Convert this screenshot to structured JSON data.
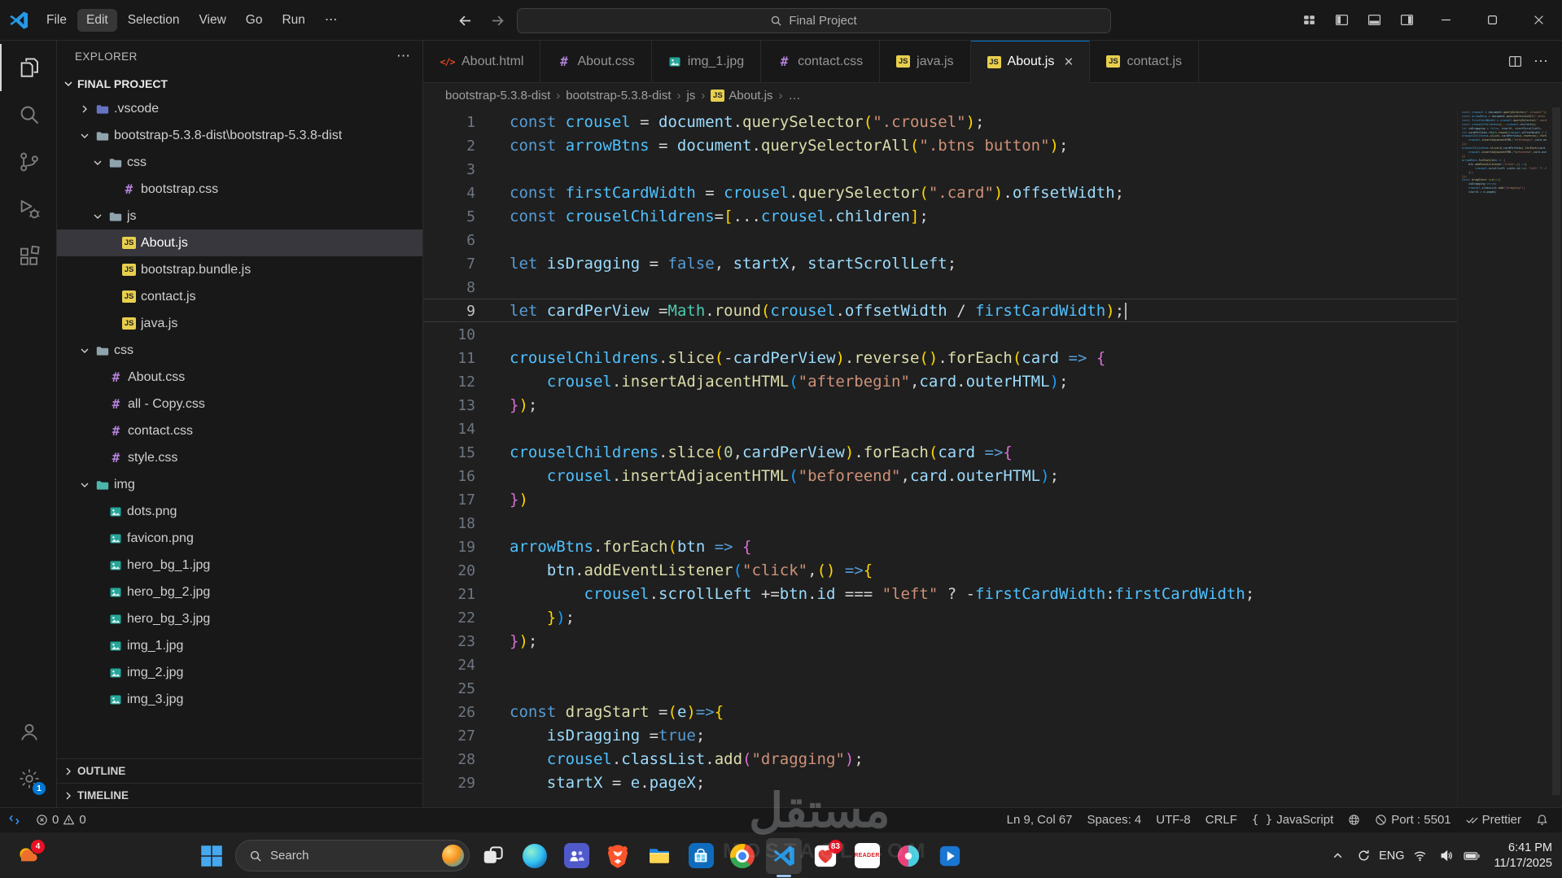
{
  "window": {
    "menus": [
      "File",
      "Edit",
      "Selection",
      "View",
      "Go",
      "Run"
    ],
    "active_menu": "Edit",
    "more_label": "⋯",
    "command_center_title": "Final Project"
  },
  "activity_bar": {
    "settings_badge": "1"
  },
  "sidebar": {
    "header": "EXPLORER",
    "section": "FINAL PROJECT",
    "tree": [
      {
        "label": ".vscode",
        "icon": "folder",
        "folder_color": "#6573c3",
        "chevron": "collapsed",
        "depth": 1
      },
      {
        "label": "bootstrap-5.3.8-dist\\bootstrap-5.3.8-dist",
        "icon": "folder",
        "folder_color": "#8fa3ad",
        "chevron": "expanded",
        "depth": 1
      },
      {
        "label": "css",
        "icon": "folder",
        "folder_color": "#8fa3ad",
        "chevron": "expanded",
        "depth": 2
      },
      {
        "label": "bootstrap.css",
        "icon": "css",
        "depth": 3
      },
      {
        "label": "js",
        "icon": "folder",
        "folder_color": "#8fa3ad",
        "chevron": "expanded",
        "depth": 2
      },
      {
        "label": "About.js",
        "icon": "js",
        "depth": 3,
        "selected": true
      },
      {
        "label": "bootstrap.bundle.js",
        "icon": "js",
        "depth": 3
      },
      {
        "label": "contact.js",
        "icon": "js",
        "depth": 3
      },
      {
        "label": "java.js",
        "icon": "js",
        "depth": 3
      },
      {
        "label": "css",
        "icon": "folder",
        "folder_color": "#8fa3ad",
        "chevron": "expanded",
        "depth": 1
      },
      {
        "label": "About.css",
        "icon": "css",
        "depth": 2
      },
      {
        "label": "all - Copy.css",
        "icon": "css",
        "depth": 2
      },
      {
        "label": "contact.css",
        "icon": "css",
        "depth": 2
      },
      {
        "label": "style.css",
        "icon": "css",
        "depth": 2
      },
      {
        "label": "img",
        "icon": "folder",
        "folder_color": "#4db6ac",
        "chevron": "expanded",
        "depth": 1
      },
      {
        "label": "dots.png",
        "icon": "img",
        "depth": 2
      },
      {
        "label": "favicon.png",
        "icon": "img",
        "depth": 2
      },
      {
        "label": "hero_bg_1.jpg",
        "icon": "img",
        "depth": 2
      },
      {
        "label": "hero_bg_2.jpg",
        "icon": "img",
        "depth": 2
      },
      {
        "label": "hero_bg_3.jpg",
        "icon": "img",
        "depth": 2
      },
      {
        "label": "img_1.jpg",
        "icon": "img",
        "depth": 2
      },
      {
        "label": "img_2.jpg",
        "icon": "img",
        "depth": 2
      },
      {
        "label": "img_3.jpg",
        "icon": "img",
        "depth": 2
      }
    ],
    "panels": [
      "OUTLINE",
      "TIMELINE"
    ]
  },
  "tabs": [
    {
      "label": "About.html",
      "icon": "html"
    },
    {
      "label": "About.css",
      "icon": "css"
    },
    {
      "label": "img_1.jpg",
      "icon": "img"
    },
    {
      "label": "contact.css",
      "icon": "css"
    },
    {
      "label": "java.js",
      "icon": "js"
    },
    {
      "label": "About.js",
      "icon": "js",
      "active": true
    },
    {
      "label": "contact.js",
      "icon": "js"
    }
  ],
  "breadcrumb": [
    "bootstrap-5.3.8-dist",
    "bootstrap-5.3.8-dist",
    "js",
    "About.js",
    "…"
  ],
  "editor": {
    "active_line": 9,
    "lines": [
      [
        [
          "k",
          "const "
        ],
        [
          "c",
          "crousel"
        ],
        [
          "p",
          " = "
        ],
        [
          "v",
          "document"
        ],
        [
          "p",
          "."
        ],
        [
          "f",
          "querySelector"
        ],
        [
          "b1",
          "("
        ],
        [
          "s",
          "\".crousel\""
        ],
        [
          "b1",
          ")"
        ],
        [
          "p",
          ";"
        ]
      ],
      [
        [
          "k",
          "const "
        ],
        [
          "c",
          "arrowBtns"
        ],
        [
          "p",
          " = "
        ],
        [
          "v",
          "document"
        ],
        [
          "p",
          "."
        ],
        [
          "f",
          "querySelectorAll"
        ],
        [
          "b1",
          "("
        ],
        [
          "s",
          "\".btns button\""
        ],
        [
          "b1",
          ")"
        ],
        [
          "p",
          ";"
        ]
      ],
      [],
      [
        [
          "k",
          "const "
        ],
        [
          "c",
          "firstCardWidth"
        ],
        [
          "p",
          " = "
        ],
        [
          "c",
          "crousel"
        ],
        [
          "p",
          "."
        ],
        [
          "f",
          "querySelector"
        ],
        [
          "b1",
          "("
        ],
        [
          "s",
          "\".card\""
        ],
        [
          "b1",
          ")"
        ],
        [
          "p",
          "."
        ],
        [
          "v",
          "offsetWidth"
        ],
        [
          "p",
          ";"
        ]
      ],
      [
        [
          "k",
          "const "
        ],
        [
          "c",
          "crouselChildrens"
        ],
        [
          "p",
          "="
        ],
        [
          "b1",
          "["
        ],
        [
          "p",
          "..."
        ],
        [
          "c",
          "crousel"
        ],
        [
          "p",
          "."
        ],
        [
          "v",
          "children"
        ],
        [
          "b1",
          "]"
        ],
        [
          "p",
          ";"
        ]
      ],
      [],
      [
        [
          "k",
          "let "
        ],
        [
          "v",
          "isDragging"
        ],
        [
          "p",
          " = "
        ],
        [
          "k",
          "false"
        ],
        [
          "p",
          ", "
        ],
        [
          "v",
          "startX"
        ],
        [
          "p",
          ", "
        ],
        [
          "v",
          "startScrollLeft"
        ],
        [
          "p",
          ";"
        ]
      ],
      [],
      [
        [
          "k",
          "let "
        ],
        [
          "v",
          "cardPerView"
        ],
        [
          "p",
          " ="
        ],
        [
          "t",
          "Math"
        ],
        [
          "p",
          "."
        ],
        [
          "f",
          "round"
        ],
        [
          "b1",
          "("
        ],
        [
          "c",
          "crousel"
        ],
        [
          "p",
          "."
        ],
        [
          "v",
          "offsetWidth"
        ],
        [
          "p",
          " / "
        ],
        [
          "c",
          "firstCardWidth"
        ],
        [
          "b1",
          ")"
        ],
        [
          "p",
          ";"
        ]
      ],
      [],
      [
        [
          "c",
          "crouselChildrens"
        ],
        [
          "p",
          "."
        ],
        [
          "f",
          "slice"
        ],
        [
          "b1",
          "("
        ],
        [
          "p",
          "-"
        ],
        [
          "v",
          "cardPerView"
        ],
        [
          "b1",
          ")"
        ],
        [
          "p",
          "."
        ],
        [
          "f",
          "reverse"
        ],
        [
          "b1",
          "()"
        ],
        [
          "p",
          "."
        ],
        [
          "f",
          "forEach"
        ],
        [
          "b1",
          "("
        ],
        [
          "v",
          "card"
        ],
        [
          "k",
          " => "
        ],
        [
          "b2",
          "{"
        ]
      ],
      [
        [
          "p",
          "    "
        ],
        [
          "c",
          "crousel"
        ],
        [
          "p",
          "."
        ],
        [
          "f",
          "insertAdjacentHTML"
        ],
        [
          "b3",
          "("
        ],
        [
          "s",
          "\"afterbegin\""
        ],
        [
          "p",
          ","
        ],
        [
          "v",
          "card"
        ],
        [
          "p",
          "."
        ],
        [
          "v",
          "outerHTML"
        ],
        [
          "b3",
          ")"
        ],
        [
          "p",
          ";"
        ]
      ],
      [
        [
          "b2",
          "}"
        ],
        [
          "b1",
          ")"
        ],
        [
          "p",
          ";"
        ]
      ],
      [],
      [
        [
          "c",
          "crouselChildrens"
        ],
        [
          "p",
          "."
        ],
        [
          "f",
          "slice"
        ],
        [
          "b1",
          "("
        ],
        [
          "n",
          "0"
        ],
        [
          "p",
          ","
        ],
        [
          "v",
          "cardPerView"
        ],
        [
          "b1",
          ")"
        ],
        [
          "p",
          "."
        ],
        [
          "f",
          "forEach"
        ],
        [
          "b1",
          "("
        ],
        [
          "v",
          "card"
        ],
        [
          "k",
          " =>"
        ],
        [
          "b2",
          "{"
        ]
      ],
      [
        [
          "p",
          "    "
        ],
        [
          "c",
          "crousel"
        ],
        [
          "p",
          "."
        ],
        [
          "f",
          "insertAdjacentHTML"
        ],
        [
          "b3",
          "("
        ],
        [
          "s",
          "\"beforeend\""
        ],
        [
          "p",
          ","
        ],
        [
          "v",
          "card"
        ],
        [
          "p",
          "."
        ],
        [
          "v",
          "outerHTML"
        ],
        [
          "b3",
          ")"
        ],
        [
          "p",
          ";"
        ]
      ],
      [
        [
          "b2",
          "}"
        ],
        [
          "b1",
          ")"
        ]
      ],
      [],
      [
        [
          "c",
          "arrowBtns"
        ],
        [
          "p",
          "."
        ],
        [
          "f",
          "forEach"
        ],
        [
          "b1",
          "("
        ],
        [
          "v",
          "btn"
        ],
        [
          "k",
          " => "
        ],
        [
          "b2",
          "{"
        ]
      ],
      [
        [
          "p",
          "    "
        ],
        [
          "v",
          "btn"
        ],
        [
          "p",
          "."
        ],
        [
          "f",
          "addEventListener"
        ],
        [
          "b3",
          "("
        ],
        [
          "s",
          "\"click\""
        ],
        [
          "p",
          ","
        ],
        [
          "b1",
          "()"
        ],
        [
          "k",
          " =>"
        ],
        [
          "b1",
          "{"
        ]
      ],
      [
        [
          "p",
          "        "
        ],
        [
          "c",
          "crousel"
        ],
        [
          "p",
          "."
        ],
        [
          "v",
          "scrollLeft"
        ],
        [
          "p",
          " +="
        ],
        [
          "v",
          "btn"
        ],
        [
          "p",
          "."
        ],
        [
          "v",
          "id"
        ],
        [
          "p",
          " === "
        ],
        [
          "s",
          "\"left\""
        ],
        [
          "p",
          " ? -"
        ],
        [
          "c",
          "firstCardWidth"
        ],
        [
          "p",
          ":"
        ],
        [
          "c",
          "firstCardWidth"
        ],
        [
          "p",
          ";"
        ]
      ],
      [
        [
          "p",
          "    "
        ],
        [
          "b1",
          "}"
        ],
        [
          "b3",
          ")"
        ],
        [
          "p",
          ";"
        ]
      ],
      [
        [
          "b2",
          "}"
        ],
        [
          "b1",
          ")"
        ],
        [
          "p",
          ";"
        ]
      ],
      [],
      [],
      [
        [
          "k",
          "const "
        ],
        [
          "f",
          "dragStart"
        ],
        [
          "p",
          " ="
        ],
        [
          "b1",
          "("
        ],
        [
          "v",
          "e"
        ],
        [
          "b1",
          ")"
        ],
        [
          "k",
          "=>"
        ],
        [
          "b1",
          "{"
        ]
      ],
      [
        [
          "p",
          "    "
        ],
        [
          "v",
          "isDragging"
        ],
        [
          "p",
          " ="
        ],
        [
          "k",
          "true"
        ],
        [
          "p",
          ";"
        ]
      ],
      [
        [
          "p",
          "    "
        ],
        [
          "c",
          "crousel"
        ],
        [
          "p",
          "."
        ],
        [
          "v",
          "classList"
        ],
        [
          "p",
          "."
        ],
        [
          "f",
          "add"
        ],
        [
          "b2",
          "("
        ],
        [
          "s",
          "\"dragging\""
        ],
        [
          "b2",
          ")"
        ],
        [
          "p",
          ";"
        ]
      ],
      [
        [
          "p",
          "    "
        ],
        [
          "v",
          "startX"
        ],
        [
          "p",
          " = "
        ],
        [
          "v",
          "e"
        ],
        [
          "p",
          "."
        ],
        [
          "v",
          "pageX"
        ],
        [
          "p",
          ";"
        ]
      ]
    ]
  },
  "status_bar": {
    "errors": "0",
    "warnings": "0",
    "cursor": "Ln 9, Col 67",
    "indent": "Spaces: 4",
    "encoding": "UTF-8",
    "eol": "CRLF",
    "language": "JavaScript",
    "port": "Port : 5501",
    "formatter": "Prettier"
  },
  "taskbar": {
    "widgets_badge": "4",
    "search_label": "Search",
    "apps": [
      {
        "icon": "task-view",
        "name": "task-view"
      },
      {
        "icon": "edge",
        "name": "edge"
      },
      {
        "icon": "teams",
        "name": "teams"
      },
      {
        "icon": "brave",
        "name": "brave"
      },
      {
        "icon": "file-explorer",
        "name": "file-explorer"
      },
      {
        "icon": "store",
        "name": "store"
      },
      {
        "icon": "chrome",
        "name": "chrome"
      },
      {
        "icon": "vscode",
        "name": "vscode",
        "active": true
      },
      {
        "icon": "red-app",
        "name": "red-app",
        "badge": "83"
      },
      {
        "icon": "reader",
        "name": "reader",
        "label": "READER"
      },
      {
        "icon": "paint",
        "name": "paint"
      },
      {
        "icon": "media-app",
        "name": "media-app"
      }
    ],
    "tray": {
      "language": "ENG",
      "time": "6:41 PM",
      "date": "11/17/2025"
    }
  },
  "watermark": {
    "primary": "مستقل",
    "secondary": "mostaql.com"
  }
}
